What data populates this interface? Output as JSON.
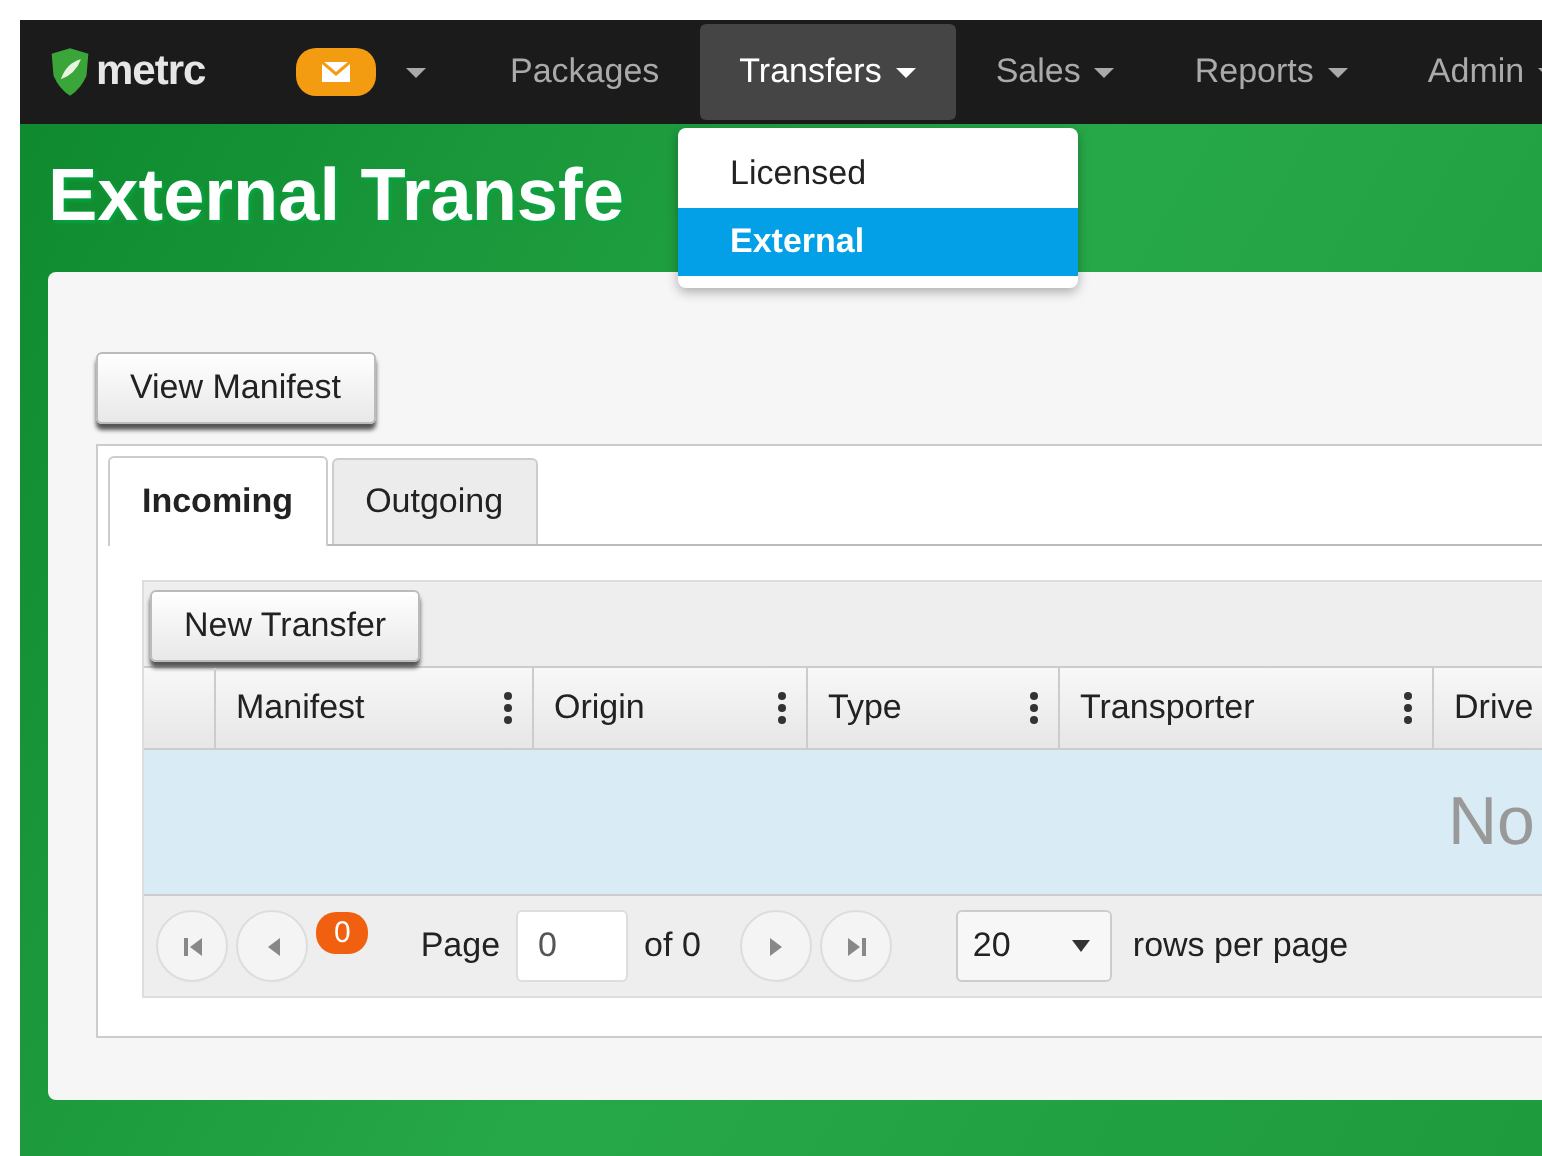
{
  "navbar": {
    "brand": "metrc",
    "mail_badge": {
      "has_caret": true
    },
    "menu": [
      {
        "label": "Packages",
        "has_caret": false,
        "selected": false
      },
      {
        "label": "Transfers",
        "has_caret": true,
        "selected": true
      },
      {
        "label": "Sales",
        "has_caret": true,
        "selected": false
      },
      {
        "label": "Reports",
        "has_caret": true,
        "selected": false
      },
      {
        "label": "Admin",
        "has_caret": true,
        "selected": false
      }
    ]
  },
  "dropdown": {
    "items": [
      {
        "label": "Licensed",
        "selected": false
      },
      {
        "label": "External",
        "selected": true
      }
    ]
  },
  "page_title": "External Transfe",
  "view_manifest_button": "View Manifest",
  "tabs": [
    {
      "label": "Incoming",
      "selected": true
    },
    {
      "label": "Outgoing",
      "selected": false
    }
  ],
  "new_transfer_button": "New Transfer",
  "table": {
    "columns": [
      "Manifest",
      "Origin",
      "Type",
      "Transporter",
      "Drive"
    ],
    "empty_message": "No"
  },
  "pager": {
    "count_badge": "0",
    "page_label": "Page",
    "page_value": "0",
    "of_label": "of 0",
    "page_size": "20",
    "rows_label": "rows per page"
  }
}
